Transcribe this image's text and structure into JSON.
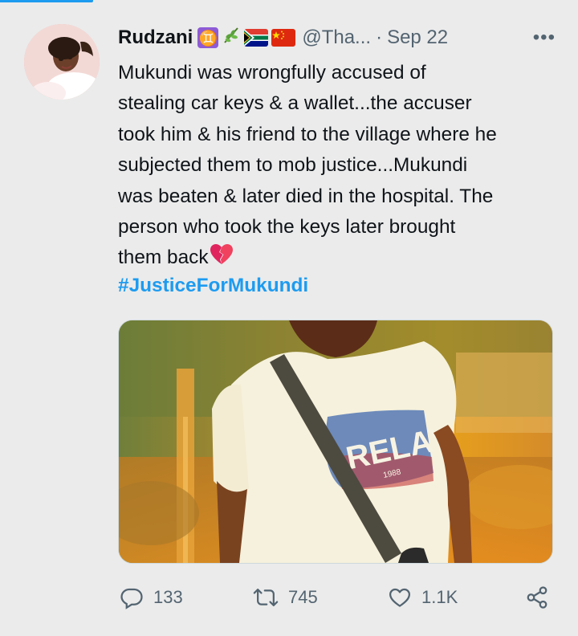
{
  "tweet": {
    "author": {
      "display_name": "Rudzani",
      "handle": "@Tha...",
      "emojis": [
        "gemini-icon",
        "herb-icon",
        "south-africa-flag-icon",
        "china-flag-icon"
      ]
    },
    "separator": "·",
    "date": "Sep 22",
    "more_label": "•••",
    "text_lines": [
      "Mukundi was wrongfully accused of",
      "stealing car keys & a wallet...the accuser",
      "took him & his friend to the village where he",
      "subjected them to mob justice...Mukundi",
      "was beaten & later died in the hospital. The",
      "person who took the keys later brought",
      "them back"
    ],
    "broken_heart_emoji": "broken-heart-icon",
    "hashtag": "#JusticeForMukundi",
    "media": {
      "shirt_text": "RELAY",
      "shirt_subtext": "1988"
    },
    "actions": {
      "reply_count": "133",
      "retweet_count": "745",
      "like_count": "1.1K"
    },
    "colors": {
      "link": "#1d9bf0",
      "secondary_text": "#536471",
      "primary_text": "#0f1419",
      "background": "#ebebeb"
    }
  }
}
